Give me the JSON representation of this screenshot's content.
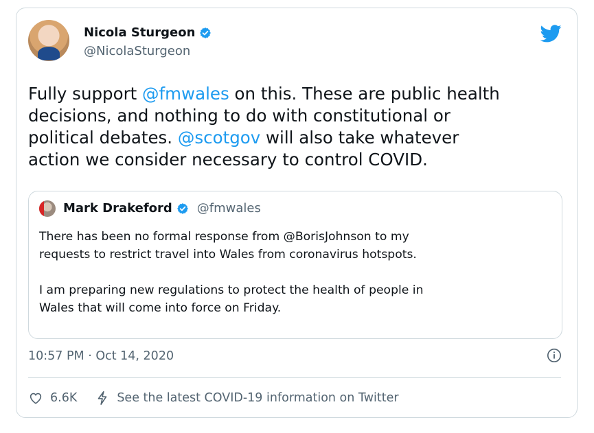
{
  "author": {
    "name": "Nicola Sturgeon",
    "handle": "@NicolaSturgeon"
  },
  "tweet": {
    "segments": [
      {
        "text": "Fully support ",
        "mention": false
      },
      {
        "text": "@fmwales",
        "mention": true
      },
      {
        "text": " on this. These are public health\ndecisions, and nothing to do with constitutional or\npolitical debates. ",
        "mention": false
      },
      {
        "text": "@scotgov",
        "mention": true
      },
      {
        "text": " will also take whatever\naction we consider necessary to control COVID.",
        "mention": false
      }
    ]
  },
  "quote": {
    "name": "Mark Drakeford",
    "handle": "@fmwales",
    "text": "There has been no formal response from @BorisJohnson to my\nrequests to restrict travel into Wales from coronavirus hotspots.\n\nI am preparing new regulations to protect the health of people in\nWales that will come into force on Friday."
  },
  "meta": {
    "timestamp": "10:57 PM · Oct 14, 2020"
  },
  "actions": {
    "like_count": "6.6K",
    "covid_link": "See the latest COVID-19 information on Twitter"
  },
  "colors": {
    "twitter_blue": "#1d9bf0",
    "text": "#0f1419",
    "muted": "#536471",
    "border": "#cfd9de"
  },
  "icons": [
    "verified-badge-icon",
    "twitter-bird-icon",
    "info-icon",
    "heart-icon",
    "lightning-icon"
  ]
}
